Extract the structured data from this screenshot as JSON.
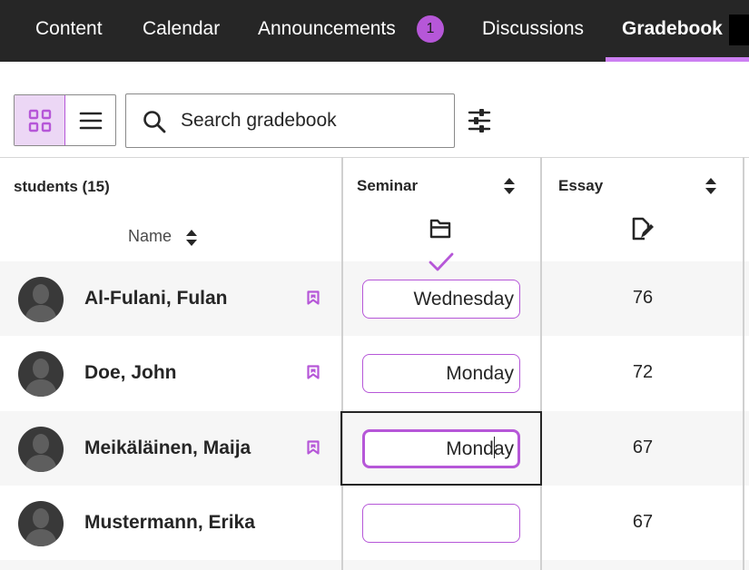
{
  "nav": {
    "tabs": [
      {
        "label": "Content"
      },
      {
        "label": "Calendar"
      },
      {
        "label": "Announcements",
        "badge": "1"
      },
      {
        "label": "Discussions"
      },
      {
        "label": "Gradebook",
        "active": true
      }
    ],
    "accent_color": "#cc7ff2",
    "background_color": "#262626"
  },
  "toolbar": {
    "view_options": [
      {
        "icon": "grid-view-icon",
        "selected": true
      },
      {
        "icon": "list-view-icon",
        "selected": false
      }
    ],
    "search": {
      "placeholder": "Search gradebook",
      "value": ""
    },
    "filter_icon": "filter-sliders-icon"
  },
  "grid": {
    "students_header": "students (15)",
    "name_header": "Name",
    "columns": [
      {
        "title": "Seminar",
        "icon": "folder-icon",
        "status_icon": "checkmark-icon"
      },
      {
        "title": "Essay",
        "icon": "document-edit-icon"
      }
    ],
    "rows": [
      {
        "name": "Al-Fulani, Fulan",
        "bookmarked": true,
        "seminar": "Wednesday",
        "essay": "76"
      },
      {
        "name": "Doe, John",
        "bookmarked": true,
        "seminar": "Monday",
        "essay": "72"
      },
      {
        "name": "Meikäläinen, Maija",
        "bookmarked": true,
        "seminar_before_cursor": "Mond",
        "seminar_after_cursor": "ay",
        "essay": "67",
        "focused": true
      },
      {
        "name": "Mustermann, Erika",
        "bookmarked": false,
        "seminar": "",
        "essay": "67"
      }
    ],
    "input_border_color": "#b657d8"
  }
}
